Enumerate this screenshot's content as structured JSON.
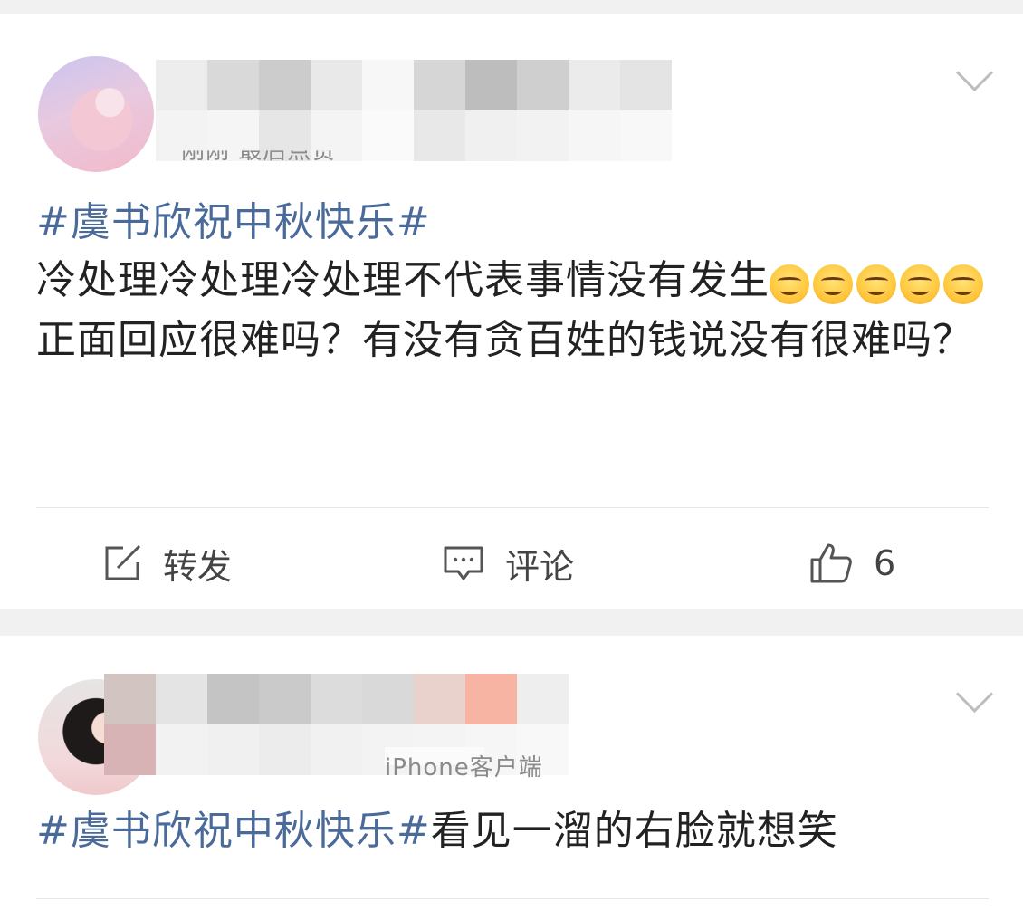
{
  "posts": [
    {
      "meta_text": "刚刚 最后点赞",
      "hashtag": "#虞书欣祝中秋快乐#",
      "line1": "冷处理冷处理冷处理不代表事情没有发生",
      "emoji_count": 5,
      "line2": "正面回应很难吗？有没有贪百姓的钱说没有很难吗？",
      "actions": {
        "repost_label": "转发",
        "comment_label": "评论",
        "like_count": "6"
      },
      "mosaic_colors": [
        "#ededed",
        "#f3f3f3",
        "#d9d9d9",
        "#f5f5f5",
        "#cccccc",
        "#e6e6e6",
        "#e9e9e9",
        "#f4f4f4",
        "#f7f7f7",
        "#fafafa",
        "#d6d6d6",
        "#e8e8e8",
        "#bdbdbd",
        "#f0f0f0",
        "#cfcfcf",
        "#f2f2f2",
        "#ebebeb",
        "#f6f6f6",
        "#e4e4e4",
        "#f8f8f8"
      ]
    },
    {
      "meta_text": "iPhone客户端",
      "hashtag": "#虞书欣祝中秋快乐#",
      "text": "看见一溜的右脸就想笑",
      "mosaic_colors": [
        "#d2c4c0",
        "#d8b3b6",
        "#e4e4e4",
        "#f2f2f2",
        "#c4c4c4",
        "#f0f0f0",
        "#cacaca",
        "#ececec",
        "#dcdcdc",
        "#f1f1f1",
        "#d9d9d9",
        "#f3f3f3",
        "#e9d2cb",
        "#f4f4f4",
        "#f7b4a3",
        "#f6f6f6",
        "#eeeeee",
        "#f8f8f8"
      ]
    }
  ]
}
